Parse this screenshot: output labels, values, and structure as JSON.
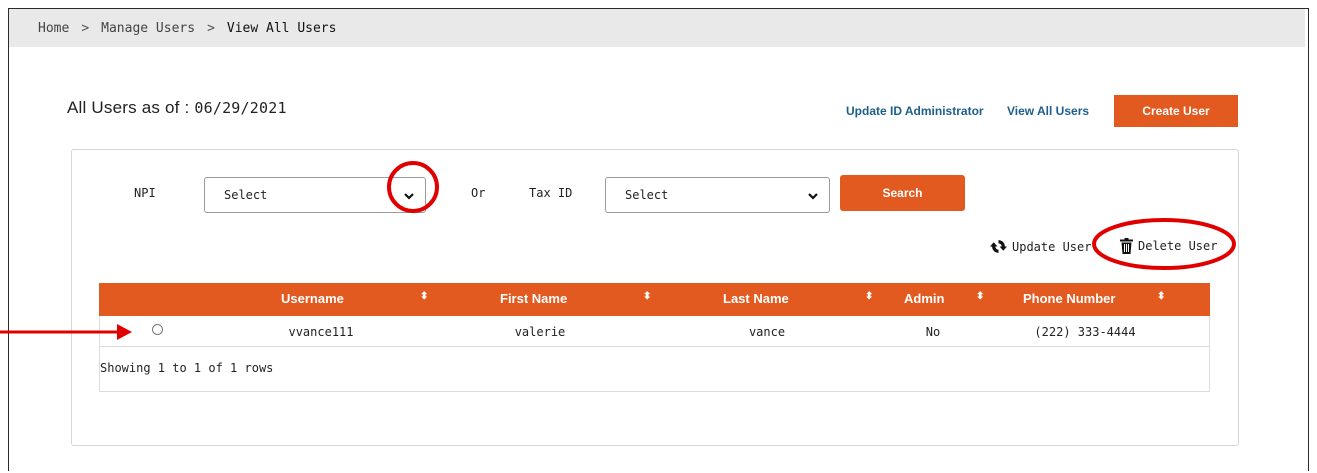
{
  "breadcrumb": {
    "home": "Home",
    "sep1": ">",
    "manage": "Manage Users",
    "sep2": ">",
    "current": "View All Users"
  },
  "header": {
    "title_prefix": "All Users as of :",
    "date": "06/29/2021",
    "link_update_admin": "Update ID Administrator",
    "link_view_all": "View All Users",
    "create_button": "Create User"
  },
  "filters": {
    "npi_label": "NPI",
    "npi_value": "Select",
    "or_label": "Or",
    "taxid_label": "Tax ID",
    "taxid_value": "Select",
    "search_button": "Search"
  },
  "actions": {
    "update_user": "Update User",
    "delete_user": "Delete User"
  },
  "table": {
    "columns": [
      "Username",
      "First Name",
      "Last Name",
      "Admin",
      "Phone Number"
    ],
    "rows": [
      {
        "username": "vvance111",
        "first_name": "valerie",
        "last_name": "vance",
        "admin": "No",
        "phone": "(222) 333-4444"
      }
    ],
    "footer": "Showing 1 to 1 of 1 rows"
  },
  "colors": {
    "accent": "#e35a21",
    "link": "#1d5f8a",
    "annotation": "#e00000"
  },
  "icons": [
    "chevron-right-icon",
    "chevron-down-icon",
    "refresh-icon",
    "trash-icon",
    "sort-icon",
    "radio-button"
  ]
}
